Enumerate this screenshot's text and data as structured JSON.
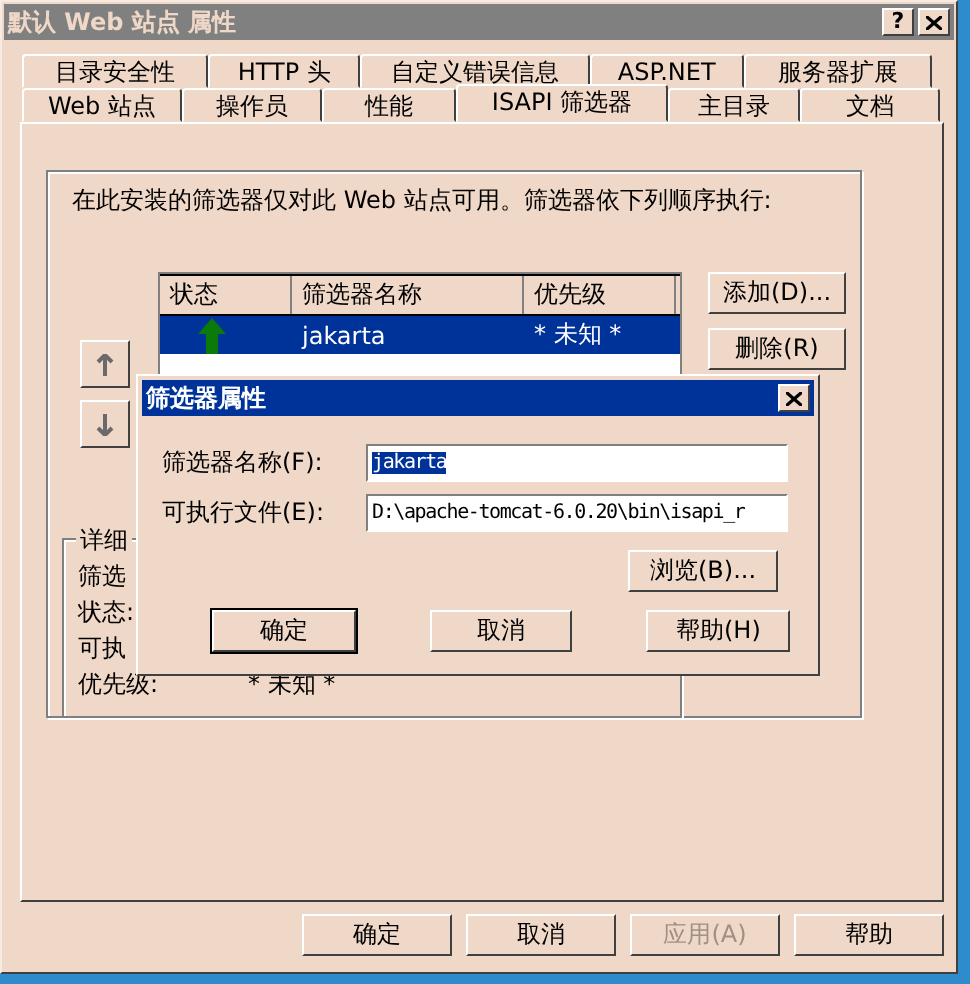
{
  "window": {
    "title": "默认 Web 站点 属性",
    "help_button": "?"
  },
  "tab_rows": [
    [
      {
        "label": "目录安全性",
        "selected": false
      },
      {
        "label": "HTTP 头",
        "selected": false
      },
      {
        "label": "自定义错误信息",
        "selected": false
      },
      {
        "label": "ASP.NET",
        "selected": false
      },
      {
        "label": "服务器扩展",
        "selected": false
      }
    ],
    [
      {
        "label": "Web 站点",
        "selected": false
      },
      {
        "label": "操作员",
        "selected": false
      },
      {
        "label": "性能",
        "selected": false
      },
      {
        "label": "ISAPI 筛选器",
        "selected": true
      },
      {
        "label": "主目录",
        "selected": false
      },
      {
        "label": "文档",
        "selected": false
      }
    ]
  ],
  "intro": "在此安装的筛选器仅对此 Web 站点可用。筛选器依下列顺序执行:",
  "filter_list": {
    "columns": [
      "状态",
      "筛选器名称",
      "优先级"
    ],
    "rows": [
      {
        "name": "jakarta",
        "priority": "* 未知 *",
        "selected": true
      }
    ]
  },
  "side_buttons": [
    "添加(D)...",
    "删除(R)"
  ],
  "details": {
    "legend": "详细",
    "lines": [
      {
        "label": "筛选"
      },
      {
        "label": "状态:"
      },
      {
        "label": "可执"
      },
      {
        "label": "优先级:",
        "value": "* 未知 *"
      }
    ]
  },
  "dialog": {
    "title": "筛选器属性",
    "fields": [
      {
        "label": "筛选器名称(F):",
        "value": "jakarta",
        "selected": true
      },
      {
        "label": "可执行文件(E):",
        "value": "D:\\apache-tomcat-6.0.20\\bin\\isapi_r",
        "selected": false
      }
    ],
    "browse": "浏览(B)...",
    "buttons": [
      {
        "label": "确定",
        "default": true
      },
      {
        "label": "取消",
        "default": false
      },
      {
        "label": "帮助(H)",
        "default": false
      }
    ]
  },
  "footer_buttons": [
    {
      "label": "确定",
      "disabled": false
    },
    {
      "label": "取消",
      "disabled": false
    },
    {
      "label": "应用(A)",
      "disabled": true
    },
    {
      "label": "帮助",
      "disabled": false
    }
  ]
}
